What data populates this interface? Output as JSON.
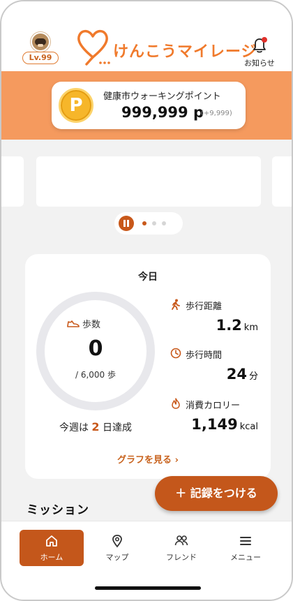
{
  "header": {
    "level": "Lv.99",
    "app_title": "けんこうマイレージ",
    "notification_label": "お知らせ"
  },
  "points": {
    "coin_letter": "P",
    "label": "健康市ウォーキングポイント",
    "value": "999,999 p",
    "delta": "(+9,999)"
  },
  "carousel": {
    "pages": 3,
    "active_page": 1
  },
  "today": {
    "title": "今日",
    "steps_label": "歩数",
    "steps_value": "0",
    "steps_goal": "/ 6,000 歩",
    "steps_progress": 0,
    "week_prefix": "今週は",
    "week_days": "2",
    "week_suffix": "日達成",
    "metrics": [
      {
        "label": "歩行距離",
        "value": "1.2",
        "unit": "km",
        "icon": "walking-icon"
      },
      {
        "label": "歩行時間",
        "value": "24",
        "unit": "分",
        "icon": "clock-icon"
      },
      {
        "label": "消費カロリー",
        "value": "1,149",
        "unit": "kcal",
        "icon": "flame-icon"
      }
    ],
    "graph_link": "グラフを見る ›"
  },
  "record_button": "＋ 記録をつける",
  "mission_title": "ミッション",
  "nav": [
    {
      "label": "ホーム",
      "icon": "home-icon",
      "active": true
    },
    {
      "label": "マップ",
      "icon": "map-pin-icon",
      "active": false
    },
    {
      "label": "フレンド",
      "icon": "friends-icon",
      "active": false
    },
    {
      "label": "メニュー",
      "icon": "menu-icon",
      "active": false
    }
  ],
  "colors": {
    "accent": "#c4571b",
    "brand_orange": "#f07a2c",
    "band_orange": "#f59a5e",
    "coin": "#f6b62a",
    "background": "#f2f2f2"
  }
}
